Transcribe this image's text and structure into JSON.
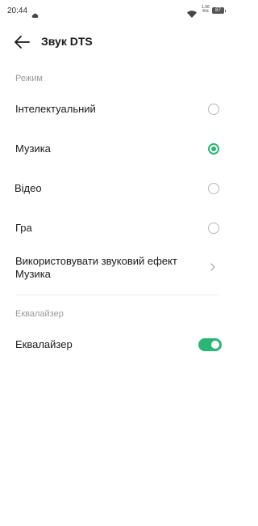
{
  "status_bar": {
    "time": "20:44",
    "speed_value": "1.56",
    "speed_unit": "K/s",
    "battery": "87",
    "icons": [
      "cloud-icon",
      "wifi-icon",
      "battery-icon"
    ]
  },
  "header": {
    "title": "Звук DTS",
    "back_icon": "arrow-left-icon"
  },
  "mode_section": {
    "label": "Режим",
    "options": [
      {
        "label": "Інтелектуальний",
        "selected": false
      },
      {
        "label": "Музика",
        "selected": true
      },
      {
        "label": "Відео",
        "selected": false
      },
      {
        "label": "Гра",
        "selected": false
      }
    ],
    "effect_link": {
      "label_line1": "Використовувати звуковий ефект",
      "label_line2": "Музика",
      "icon": "chevron-right-icon"
    }
  },
  "equalizer_section": {
    "label": "Еквалайзер",
    "toggle_label": "Еквалайзер",
    "toggle_on": true
  },
  "colors": {
    "accent": "#2bb673",
    "muted_text": "#9a9a9a"
  }
}
